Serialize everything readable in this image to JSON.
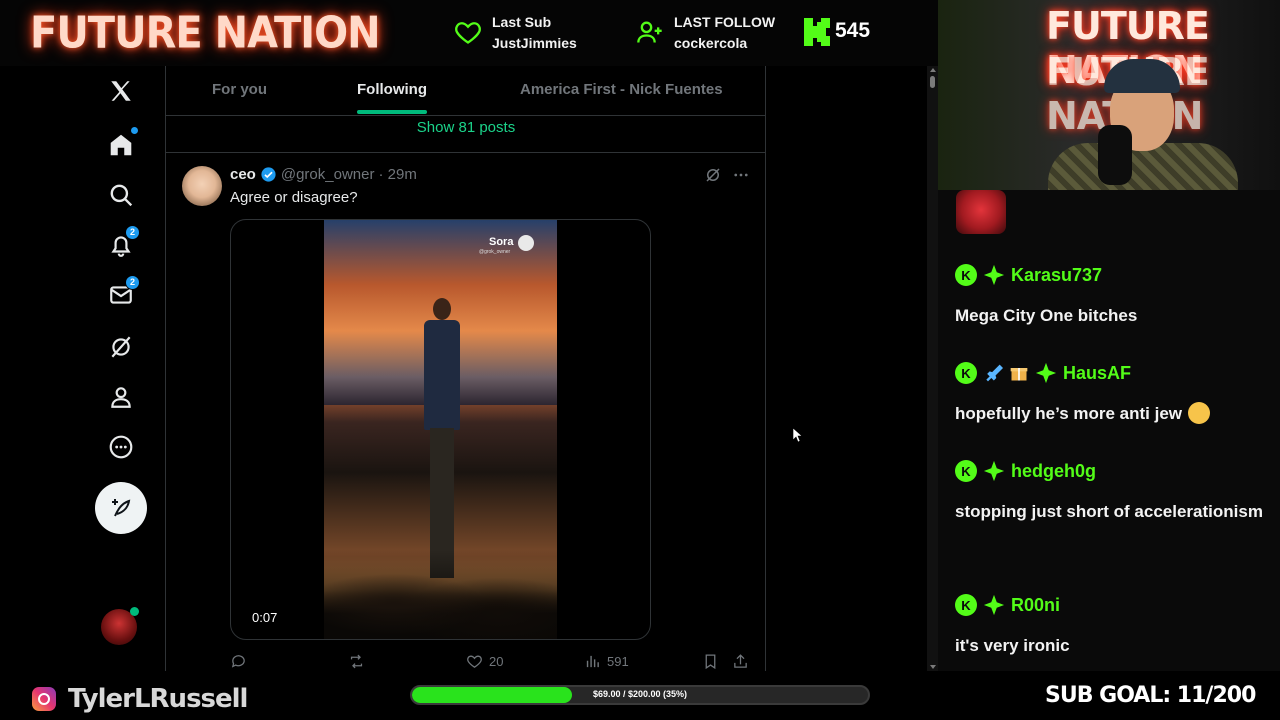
{
  "overlay": {
    "brand": "FUTURE NATION",
    "last_sub_label": "Last Sub",
    "last_sub_name": "JustJimmies",
    "last_follow_label": "LAST FOLLOW",
    "last_follow_name": "cockercola",
    "kick_count": "545",
    "accent_green": "#53fc18",
    "instagram_handle": "TylerLRussell",
    "goal_text": "$69.00 / $200.00 (35%)",
    "goal_progress": 0.35,
    "sub_goal": "SUB GOAL: 11/200"
  },
  "x_sidebar": {
    "items": [
      {
        "icon": "x-logo-icon"
      },
      {
        "icon": "home-icon"
      },
      {
        "icon": "search-icon"
      },
      {
        "icon": "bell-icon",
        "badge": "2"
      },
      {
        "icon": "mail-icon",
        "badge": "2"
      },
      {
        "icon": "grok-icon"
      },
      {
        "icon": "profile-icon"
      },
      {
        "icon": "more-icon"
      }
    ],
    "compose_icon": "feather-plus-icon"
  },
  "x_feed": {
    "tabs": [
      {
        "label": "For you"
      },
      {
        "label": "Following"
      },
      {
        "label": "America First - Nick Fuentes"
      }
    ],
    "active_tab": "Following",
    "show_posts": "Show 81 posts",
    "post": {
      "name": "ceo",
      "handle": "@grok_owner",
      "time": "· 29m",
      "text": "Agree or disagree?",
      "video_duration": "0:07",
      "watermark": "Sora",
      "watermark_handle": "@grok_owner",
      "likes": "20",
      "views": "591"
    }
  },
  "chat": {
    "messages": [
      {
        "user": "Karasu737",
        "text": "Mega City One bitches",
        "badges": [
          "kick-badge",
          "sparkle-badge"
        ]
      },
      {
        "user": "HausAF",
        "text": "hopefully he’s more anti jew",
        "badges": [
          "kick-badge",
          "sword-badge",
          "gift-badge",
          "sparkle-badge"
        ],
        "emoji": "screaming-face-emoji"
      },
      {
        "user": "hedgeh0g",
        "text": "stopping just short of accelerationism",
        "badges": [
          "kick-badge",
          "sparkle-badge"
        ]
      },
      {
        "user": "R00ni",
        "text": "it's very ironic",
        "badges": [
          "kick-badge",
          "sparkle-badge"
        ]
      }
    ]
  }
}
